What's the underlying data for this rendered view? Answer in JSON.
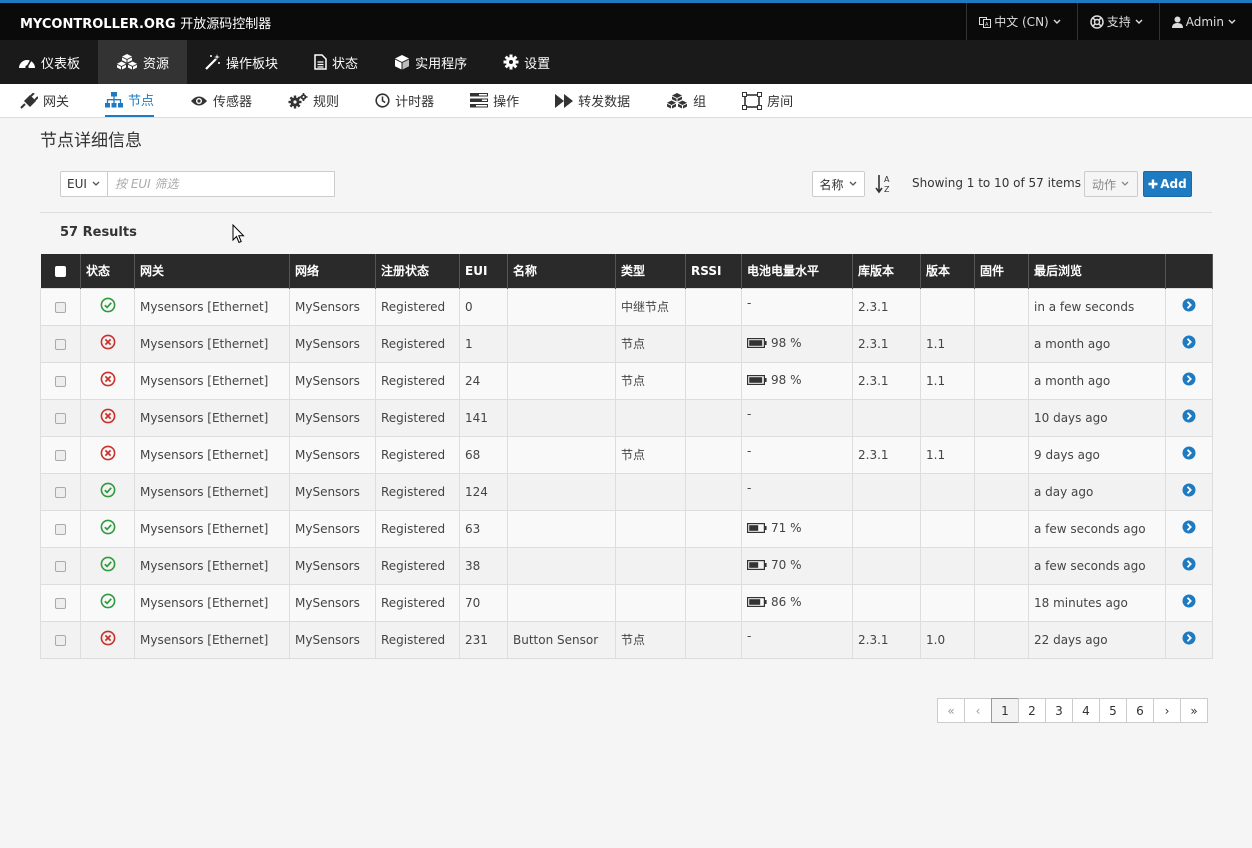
{
  "topbar": {
    "brand": "MYCONTROLLER.ORG",
    "brand_sub": "开放源码控制器",
    "language": "中文 (CN)",
    "support": "支持",
    "user": "Admin"
  },
  "mainnav": [
    {
      "label": "仪表板",
      "icon": "dashboard-icon"
    },
    {
      "label": "资源",
      "icon": "cubes-icon"
    },
    {
      "label": "操作板块",
      "icon": "magic-wand-icon"
    },
    {
      "label": "状态",
      "icon": "document-icon"
    },
    {
      "label": "实用程序",
      "icon": "cube-icon"
    },
    {
      "label": "设置",
      "icon": "gear-icon"
    }
  ],
  "subnav": [
    {
      "label": "网关",
      "icon": "plug-icon"
    },
    {
      "label": "节点",
      "icon": "sitemap-icon"
    },
    {
      "label": "传感器",
      "icon": "eye-icon"
    },
    {
      "label": "规则",
      "icon": "gears-icon"
    },
    {
      "label": "计时器",
      "icon": "clock-icon"
    },
    {
      "label": "操作",
      "icon": "tasks-icon"
    },
    {
      "label": "转发数据",
      "icon": "forward-icon"
    },
    {
      "label": "组",
      "icon": "cubes-icon"
    },
    {
      "label": "房间",
      "icon": "frame-icon"
    }
  ],
  "page": {
    "title": "节点详细信息",
    "filter_field": "EUI",
    "filter_placeholder": "按 EUI 筛选",
    "sort_field": "名称",
    "showing": "Showing 1 to 10 of 57 items",
    "action_label": "动作",
    "add_label": "Add",
    "results": "57 Results"
  },
  "table": {
    "headers": [
      "状态",
      "网关",
      "网络",
      "注册状态",
      "EUI",
      "名称",
      "类型",
      "RSSI",
      "电池电量水平",
      "库版本",
      "版本",
      "固件",
      "最后浏览"
    ],
    "rows": [
      {
        "status": "ok",
        "gateway": "Mysensors [Ethernet]",
        "network": "MySensors",
        "reg": "Registered",
        "eui": "0",
        "name": "",
        "type": "中继节点",
        "rssi": "",
        "battery": "-",
        "battery_pct": null,
        "lib": "2.3.1",
        "version": "",
        "firmware": "",
        "last_seen": "in a few seconds"
      },
      {
        "status": "err",
        "gateway": "Mysensors [Ethernet]",
        "network": "MySensors",
        "reg": "Registered",
        "eui": "1",
        "name": "",
        "type": "节点",
        "rssi": "",
        "battery": "98 %",
        "battery_pct": 98,
        "lib": "2.3.1",
        "version": "1.1",
        "firmware": "",
        "last_seen": "a month ago"
      },
      {
        "status": "err",
        "gateway": "Mysensors [Ethernet]",
        "network": "MySensors",
        "reg": "Registered",
        "eui": "24",
        "name": "",
        "type": "节点",
        "rssi": "",
        "battery": "98 %",
        "battery_pct": 98,
        "lib": "2.3.1",
        "version": "1.1",
        "firmware": "",
        "last_seen": "a month ago"
      },
      {
        "status": "err",
        "gateway": "Mysensors [Ethernet]",
        "network": "MySensors",
        "reg": "Registered",
        "eui": "141",
        "name": "",
        "type": "",
        "rssi": "",
        "battery": "-",
        "battery_pct": null,
        "lib": "",
        "version": "",
        "firmware": "",
        "last_seen": "10 days ago"
      },
      {
        "status": "err",
        "gateway": "Mysensors [Ethernet]",
        "network": "MySensors",
        "reg": "Registered",
        "eui": "68",
        "name": "",
        "type": "节点",
        "rssi": "",
        "battery": "-",
        "battery_pct": null,
        "lib": "2.3.1",
        "version": "1.1",
        "firmware": "",
        "last_seen": "9 days ago"
      },
      {
        "status": "ok",
        "gateway": "Mysensors [Ethernet]",
        "network": "MySensors",
        "reg": "Registered",
        "eui": "124",
        "name": "",
        "type": "",
        "rssi": "",
        "battery": "-",
        "battery_pct": null,
        "lib": "",
        "version": "",
        "firmware": "",
        "last_seen": "a day ago"
      },
      {
        "status": "ok",
        "gateway": "Mysensors [Ethernet]",
        "network": "MySensors",
        "reg": "Registered",
        "eui": "63",
        "name": "",
        "type": "",
        "rssi": "",
        "battery": "71 %",
        "battery_pct": 71,
        "lib": "",
        "version": "",
        "firmware": "",
        "last_seen": "a few seconds ago"
      },
      {
        "status": "ok",
        "gateway": "Mysensors [Ethernet]",
        "network": "MySensors",
        "reg": "Registered",
        "eui": "38",
        "name": "",
        "type": "",
        "rssi": "",
        "battery": "70 %",
        "battery_pct": 70,
        "lib": "",
        "version": "",
        "firmware": "",
        "last_seen": "a few seconds ago"
      },
      {
        "status": "ok",
        "gateway": "Mysensors [Ethernet]",
        "network": "MySensors",
        "reg": "Registered",
        "eui": "70",
        "name": "",
        "type": "",
        "rssi": "",
        "battery": "86 %",
        "battery_pct": 86,
        "lib": "",
        "version": "",
        "firmware": "",
        "last_seen": "18 minutes ago"
      },
      {
        "status": "err",
        "gateway": "Mysensors [Ethernet]",
        "network": "MySensors",
        "reg": "Registered",
        "eui": "231",
        "name": "Button Sensor",
        "type": "节点",
        "rssi": "",
        "battery": "-",
        "battery_pct": null,
        "lib": "2.3.1",
        "version": "1.0",
        "firmware": "",
        "last_seen": "22 days ago"
      }
    ]
  },
  "pagination": {
    "first": "«",
    "prev": "‹",
    "pages": [
      "1",
      "2",
      "3",
      "4",
      "5",
      "6"
    ],
    "next": "›",
    "last": "»"
  },
  "colors": {
    "accent": "#1e7bc2",
    "ok": "#2e9a3e",
    "err": "#c9302c"
  }
}
